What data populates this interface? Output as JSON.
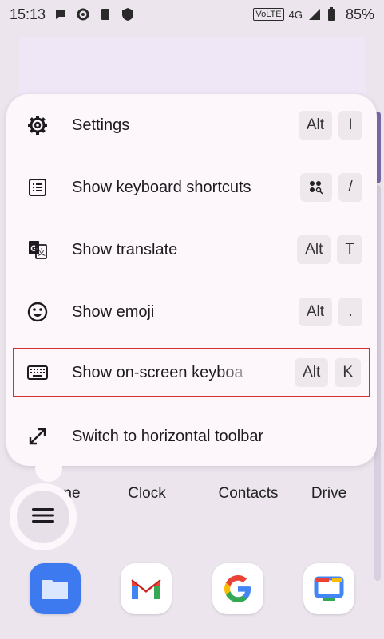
{
  "status_bar": {
    "time": "15:13",
    "network_label": "VoLTE",
    "network_type": "4G",
    "battery_percent": "85%"
  },
  "menu": {
    "items": [
      {
        "label": "Settings",
        "icon": "gear-icon",
        "keys": [
          "Alt",
          "I"
        ]
      },
      {
        "label": "Show keyboard shortcuts",
        "icon": "list-icon",
        "keys": [
          "",
          "/"
        ]
      },
      {
        "label": "Show translate",
        "icon": "translate-icon",
        "keys": [
          "Alt",
          "T"
        ]
      },
      {
        "label": "Show emoji",
        "icon": "emoji-icon",
        "keys": [
          "Alt",
          "."
        ]
      },
      {
        "label": "Show on-screen keyboa",
        "icon": "keyboard-icon",
        "keys": [
          "Alt",
          "K"
        ]
      },
      {
        "label": "Switch to horizontal toolbar",
        "icon": "resize-icon",
        "keys": []
      }
    ]
  },
  "apps": {
    "row_labels": [
      "ne",
      "Clock",
      "Contacts",
      "Drive"
    ],
    "dock_labels": [
      "Files",
      "Gmail",
      "Google",
      "Google TV"
    ]
  },
  "colors": {
    "menu_bg": "#fdf7fb",
    "highlight": "#d32f2f",
    "key_bg": "#eee7ec"
  }
}
